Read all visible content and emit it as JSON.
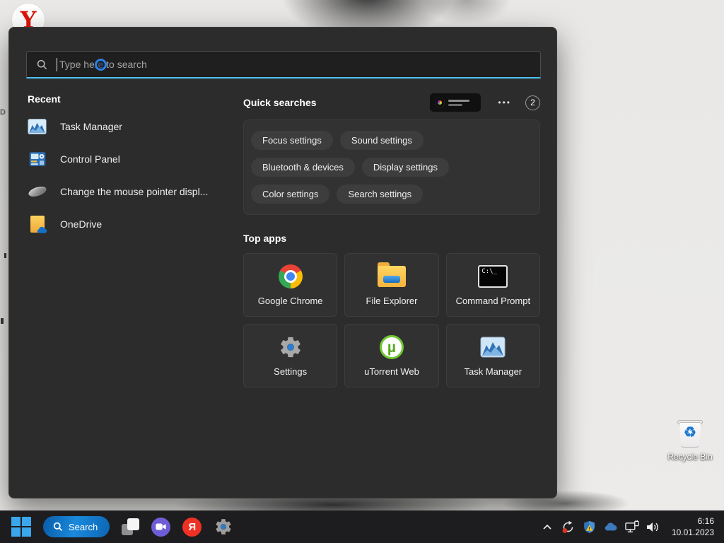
{
  "colors": {
    "accent": "#4cc2ff",
    "panel_bg": "#2c2c2c",
    "taskbar_bg": "#1d1d20",
    "chip_bg": "#3d3d3d",
    "tile_bg": "#313131",
    "search_pill_blue": "#1a89dc",
    "yandex_red": "#ee3124",
    "warning_yellow": "#f6c51d"
  },
  "desktop": {
    "yandex_glyph": "Y",
    "edge_fragment": "D",
    "recycle_glyph": "♻",
    "recycle_bin_label": "Recycle Bin"
  },
  "search_panel": {
    "search": {
      "placeholder": "Type here to search"
    },
    "recent": {
      "title": "Recent",
      "items": [
        {
          "label": "Task Manager"
        },
        {
          "label": "Control Panel"
        },
        {
          "label": "Change the mouse pointer displ..."
        },
        {
          "label": "OneDrive"
        }
      ]
    },
    "quick_searches": {
      "title": "Quick searches",
      "more": "•••",
      "badge": "2",
      "chips": [
        "Focus settings",
        "Sound settings",
        "Bluetooth & devices",
        "Display settings",
        "Color settings",
        "Search settings"
      ]
    },
    "top_apps": {
      "title": "Top apps",
      "apps": [
        {
          "label": "Google Chrome"
        },
        {
          "label": "File Explorer"
        },
        {
          "label": "Command Prompt",
          "glyph": "C:\\_"
        },
        {
          "label": "Settings"
        },
        {
          "label": "uTorrent Web",
          "glyph": "µ"
        },
        {
          "label": "Task Manager"
        }
      ]
    }
  },
  "taskbar": {
    "search_label": "Search",
    "yandex_glyph": "Я",
    "tray": {
      "time": "6:16",
      "date": "10.01.2023"
    }
  }
}
